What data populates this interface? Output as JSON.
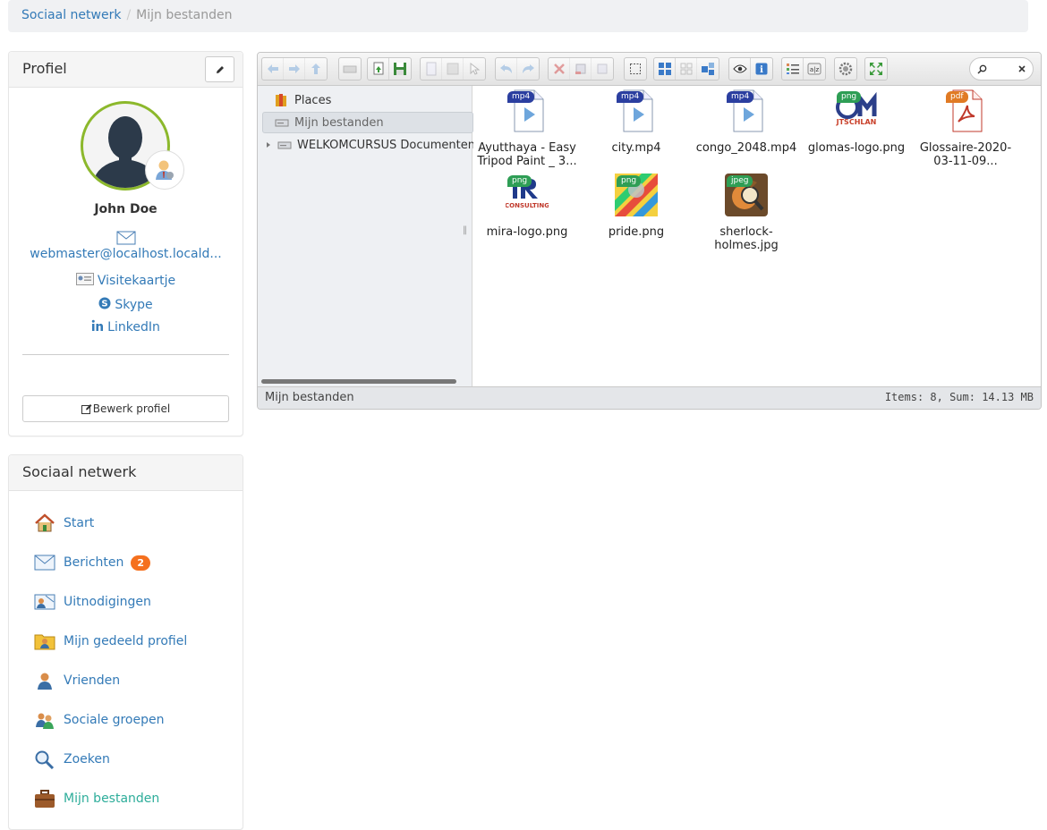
{
  "breadcrumb": {
    "items": [
      "Sociaal netwerk"
    ],
    "current": "Mijn bestanden"
  },
  "profile": {
    "heading": "Profiel",
    "name": "John Doe",
    "email": "webmaster@localhost.locald...",
    "vcard": "Visitekaartje",
    "skype": "Skype",
    "linkedin": "LinkedIn",
    "edit_button": "Bewerk profiel"
  },
  "social": {
    "heading": "Sociaal netwerk",
    "items": [
      {
        "label": "Start",
        "icon": "home-icon"
      },
      {
        "label": "Berichten",
        "icon": "envelope-icon",
        "badge": "2"
      },
      {
        "label": "Uitnodigingen",
        "icon": "invitation-icon"
      },
      {
        "label": "Mijn gedeeld profiel",
        "icon": "shared-profile-icon"
      },
      {
        "label": "Vrienden",
        "icon": "friend-icon"
      },
      {
        "label": "Sociale groepen",
        "icon": "group-icon"
      },
      {
        "label": "Zoeken",
        "icon": "magnifier-icon"
      },
      {
        "label": "Mijn bestanden",
        "icon": "briefcase-icon",
        "active": true
      }
    ]
  },
  "filemanager": {
    "nav": {
      "places": "Places",
      "mine": "Mijn bestanden",
      "course": "WELKOMCURSUS Documenten"
    },
    "files": [
      {
        "name": "Ayutthaya - Easy Tripod Paint _ 3...",
        "type": "mp4",
        "tag_color": "#2b3fa0"
      },
      {
        "name": "city.mp4",
        "type": "mp4",
        "tag_color": "#2b3fa0"
      },
      {
        "name": "congo_2048.mp4",
        "type": "mp4",
        "tag_color": "#2b3fa0"
      },
      {
        "name": "glomas-logo.png",
        "type": "png",
        "tag_color": "#2e9e55"
      },
      {
        "name": "Glossaire-2020-03-11-09...",
        "type": "pdf",
        "tag_color": "#e07a24"
      },
      {
        "name": "mira-logo.png",
        "type": "png",
        "tag_color": "#2e9e55"
      },
      {
        "name": "pride.png",
        "type": "png",
        "tag_color": "#2e9e55"
      },
      {
        "name": "sherlock-holmes.jpg",
        "type": "jpeg",
        "tag_color": "#2e9e55"
      }
    ],
    "status_left": "Mijn bestanden",
    "status_right": "Items: 8, Sum: 14.13 MB"
  },
  "colors": {
    "link": "#337ab7",
    "active": "#2dad9a",
    "badge": "#f5701e",
    "avatar_ring": "#8cb82c"
  }
}
